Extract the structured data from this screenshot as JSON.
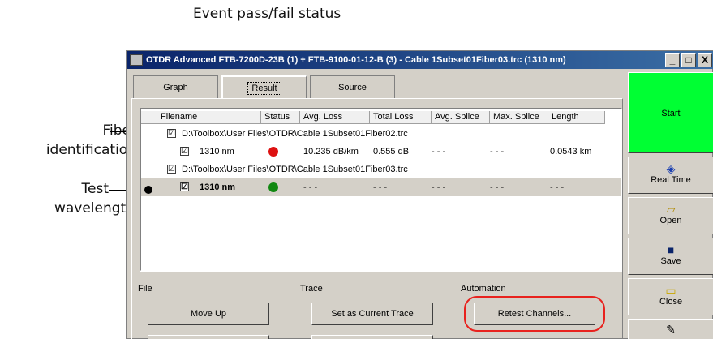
{
  "callouts": {
    "status": "Event pass/fail status",
    "fiber_line1": "Fiber",
    "fiber_line2": "identification",
    "test_line1": "Test",
    "test_line2": "wavelength"
  },
  "window": {
    "title": "OTDR Advanced FTB-7200D-23B (1) + FTB-9100-01-12-B (3) - Cable 1Subset01Fiber03.trc (1310 nm)",
    "minimize": "_",
    "maximize": "□",
    "close": "X"
  },
  "tabs": [
    "Graph",
    "Result",
    "Source"
  ],
  "table": {
    "columns": [
      "Filename",
      "Status",
      "Avg. Loss",
      "Total Loss",
      "Avg. Splice",
      "Max. Splice",
      "Length"
    ],
    "rows": [
      {
        "type": "file",
        "checked": "☑",
        "filename": "D:\\Toolbox\\User Files\\OTDR\\Cable 1Subset01Fiber02.trc"
      },
      {
        "type": "wave",
        "checked": "☑",
        "wavelength": "1310 nm",
        "status": "fail",
        "avg_loss": "10.235 dB/km",
        "total_loss": "0.555 dB",
        "avg_splice": "- - -",
        "max_splice": "- - -",
        "length": "0.0543 km"
      },
      {
        "type": "file",
        "checked": "☑",
        "filename": "D:\\Toolbox\\User Files\\OTDR\\Cable 1Subset01Fiber03.trc"
      },
      {
        "type": "wave",
        "checked": "☑",
        "wavelength": "1310 nm",
        "status": "pass",
        "avg_loss": "- - -",
        "total_loss": "- - -",
        "avg_splice": "- - -",
        "max_splice": "- - -",
        "length": "- - -",
        "selected": true
      }
    ]
  },
  "sections": {
    "file": "File",
    "trace": "Trace",
    "automation": "Automation"
  },
  "buttons": {
    "move_up": "Move Up",
    "set_current": "Set as Current Trace",
    "retest": "Retest Channels..."
  },
  "sidebar": {
    "start": "Start",
    "real_time": "Real Time",
    "open": "Open",
    "save": "Save",
    "close": "Close"
  },
  "colors": {
    "start_green": "#00ff33",
    "fail_red": "#dd1111",
    "pass_green": "#118811",
    "highlight_ring": "#e8221e"
  }
}
